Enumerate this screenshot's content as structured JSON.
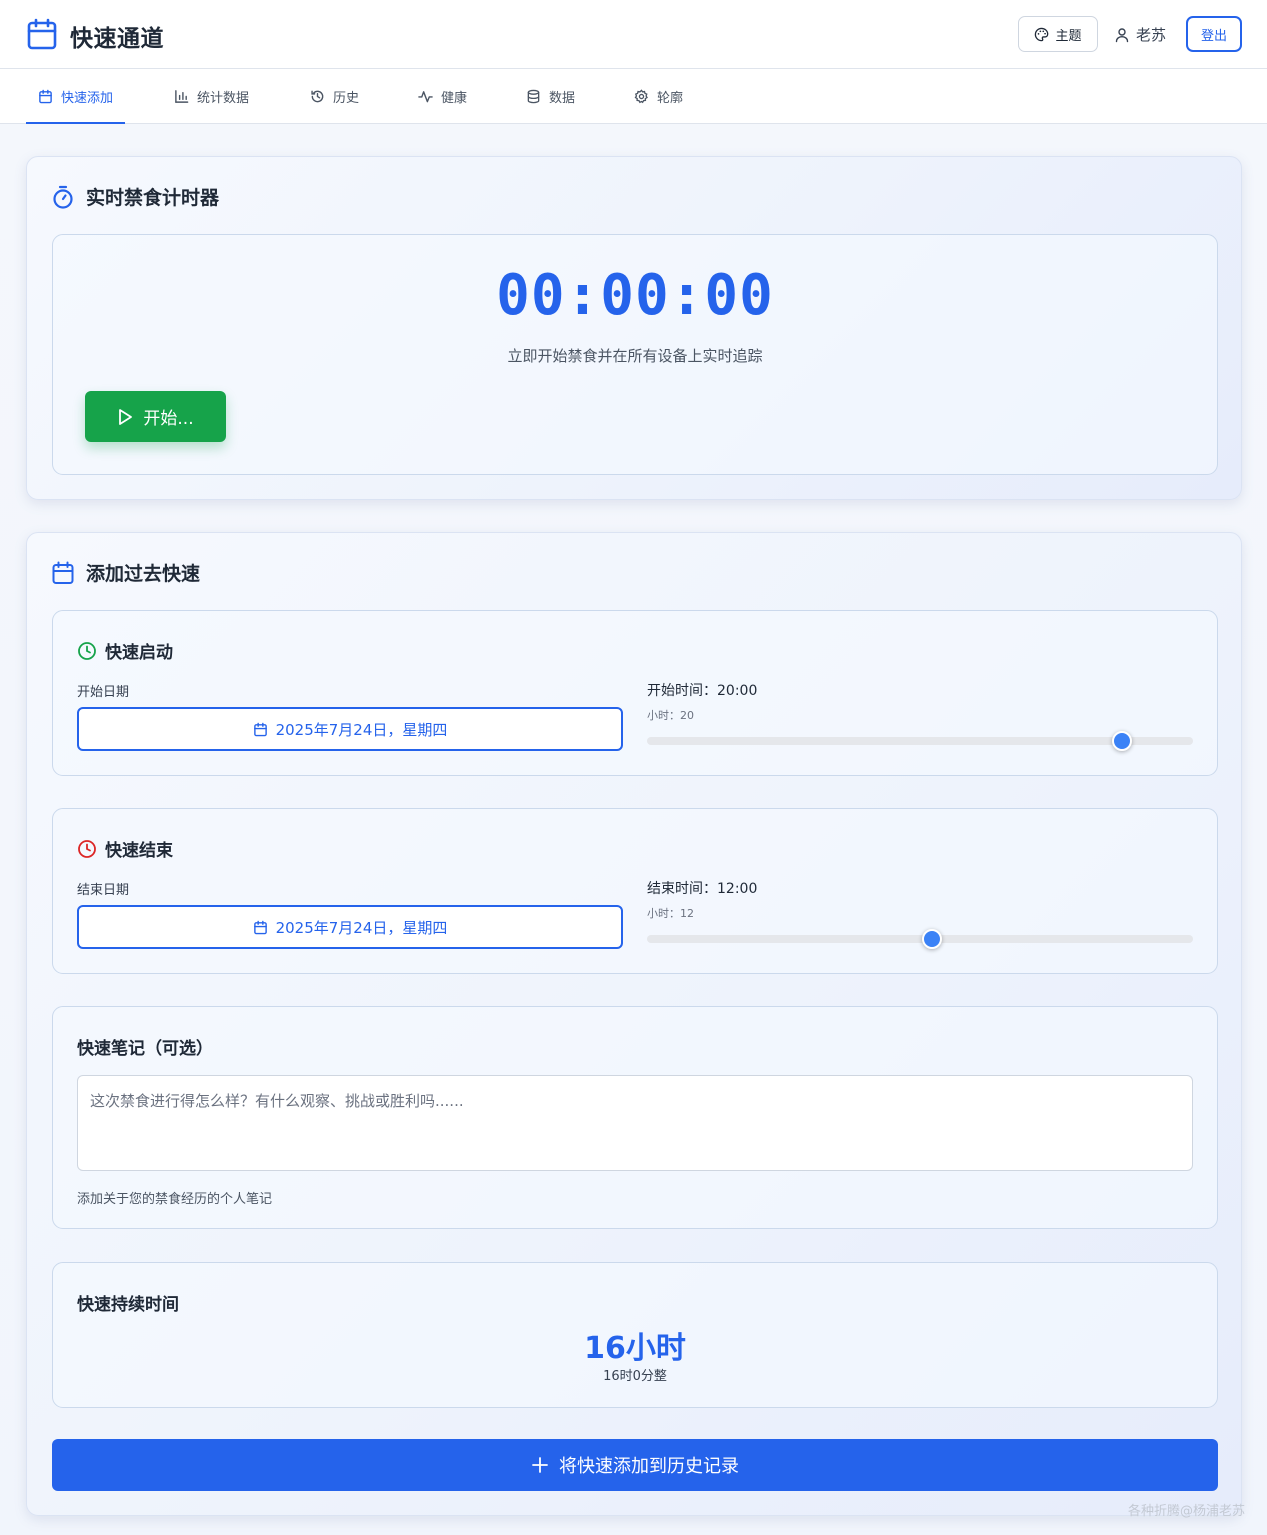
{
  "header": {
    "app_title": "快速通道",
    "theme_label": "主题",
    "user_name": "老苏",
    "logout_label": "登出"
  },
  "tabs": [
    {
      "label": "快速添加",
      "icon": "calendar-icon",
      "active": true
    },
    {
      "label": "统计数据",
      "icon": "bar-chart-icon",
      "active": false
    },
    {
      "label": "历史",
      "icon": "history-icon",
      "active": false
    },
    {
      "label": "健康",
      "icon": "activity-icon",
      "active": false
    },
    {
      "label": "数据",
      "icon": "database-icon",
      "active": false
    },
    {
      "label": "轮廓",
      "icon": "gear-icon",
      "active": false
    }
  ],
  "timer_card": {
    "title": "实时禁食计时器",
    "display": "00:00:00",
    "subtitle": "立即开始禁食并在所有设备上实时追踪",
    "start_label": "开始..."
  },
  "past_card": {
    "title": "添加过去快速",
    "start": {
      "heading": "快速启动",
      "date_label": "开始日期",
      "date_value": "2025年7月24日，星期四",
      "time_label": "开始时间：20:00",
      "hour_label": "小时：20",
      "hour": 20,
      "hour_max": 23
    },
    "end": {
      "heading": "快速结束",
      "date_label": "结束日期",
      "date_value": "2025年7月24日，星期四",
      "time_label": "结束时间：12:00",
      "hour_label": "小时：12",
      "hour": 12,
      "hour_max": 23
    },
    "notes": {
      "heading": "快速笔记（可选）",
      "placeholder": "这次禁食进行得怎么样？有什么观察、挑战或胜利吗......",
      "value": "",
      "hint": "添加关于您的禁食经历的个人笔记"
    },
    "duration": {
      "heading": "快速持续时间",
      "value": "16小时",
      "detail": "16时0分整"
    },
    "add_label": "将快速添加到历史记录"
  },
  "watermark": "各种折腾@杨浦老苏",
  "colors": {
    "accent": "#2563eb",
    "start_green": "#16a34a",
    "end_red": "#dc2626",
    "slider_thumb": "#3b82f6"
  }
}
